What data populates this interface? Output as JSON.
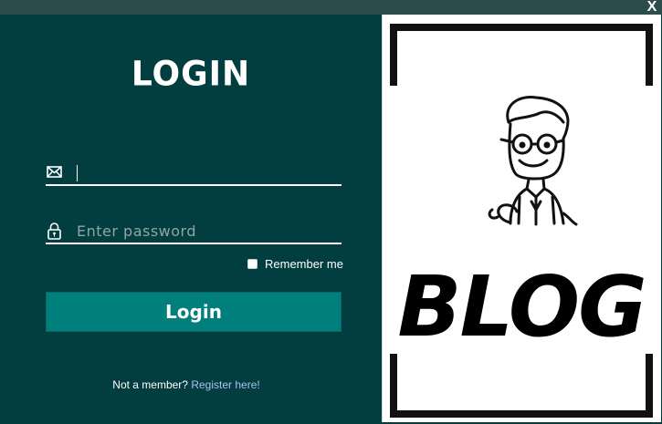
{
  "window": {
    "close_label": "X"
  },
  "login": {
    "title": "LOGIN",
    "email": {
      "value": "",
      "placeholder": ""
    },
    "password": {
      "value": "",
      "placeholder": "Enter password"
    },
    "remember_label": "Remember me",
    "remember_checked": false,
    "button_label": "Login",
    "register_prompt": "Not a member?",
    "register_link": "Register here!"
  },
  "banner": {
    "logo_text": "BLOG"
  },
  "colors": {
    "background": "#023d3f",
    "titlebar": "#2d4c4b",
    "button": "#007f7c",
    "link": "#a9c2f0"
  },
  "icons": {
    "email": "envelope-icon",
    "password": "padlock-icon"
  }
}
